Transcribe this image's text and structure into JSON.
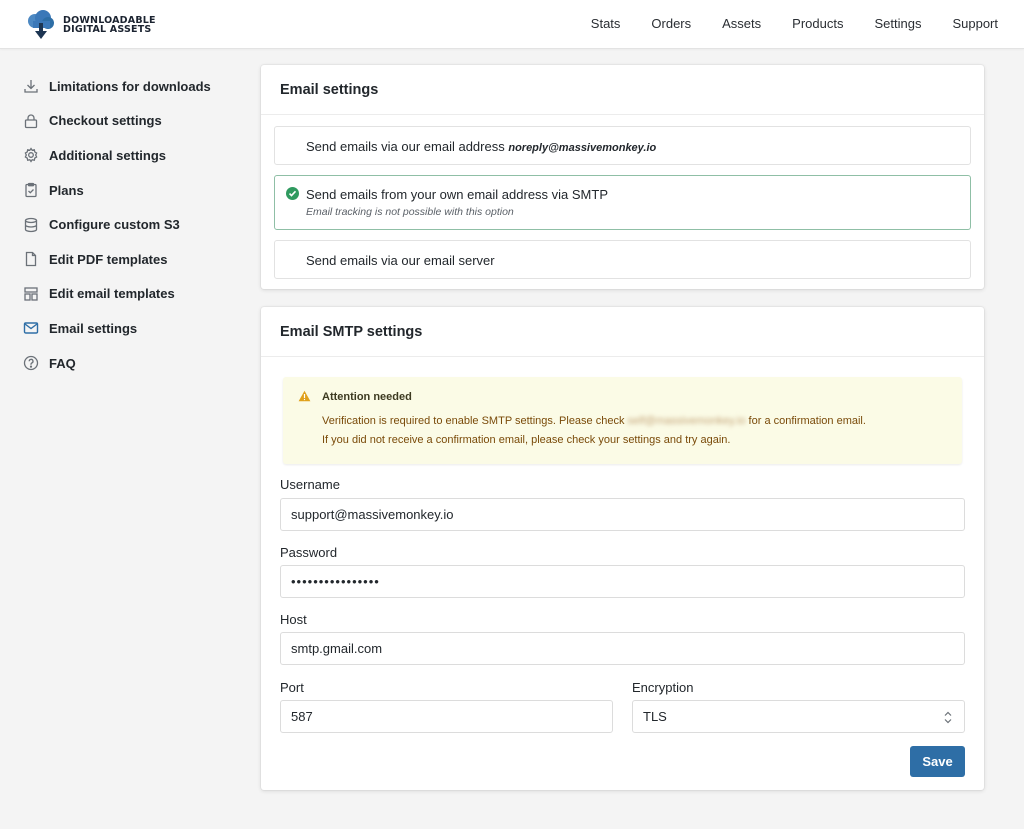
{
  "brand": {
    "line1": "DOWNLOADABLE",
    "line2": "DIGITAL ASSETS"
  },
  "nav": [
    "Stats",
    "Orders",
    "Assets",
    "Products",
    "Settings",
    "Support"
  ],
  "sidebar": {
    "items": [
      {
        "label": "Limitations for downloads",
        "icon": "download-icon"
      },
      {
        "label": "Checkout settings",
        "icon": "lock-icon"
      },
      {
        "label": "Additional settings",
        "icon": "gear-icon"
      },
      {
        "label": "Plans",
        "icon": "clipboard-icon"
      },
      {
        "label": "Configure custom S3",
        "icon": "database-icon"
      },
      {
        "label": "Edit PDF templates",
        "icon": "document-icon"
      },
      {
        "label": "Edit email templates",
        "icon": "template-icon"
      },
      {
        "label": "Email settings",
        "icon": "envelope-icon"
      },
      {
        "label": "FAQ",
        "icon": "question-icon"
      }
    ]
  },
  "email_settings": {
    "title": "Email settings",
    "options": [
      {
        "label": "Send emails via our email address",
        "address": "noreply@massivemonkey.io"
      },
      {
        "label": "Send emails from your own email address via SMTP",
        "note": "Email tracking is not possible with this option",
        "selected": true
      },
      {
        "label": "Send emails via our email server"
      }
    ]
  },
  "smtp": {
    "title": "Email SMTP settings",
    "alert": {
      "title": "Attention needed",
      "line1_start": "Verification is required to enable SMTP settings. Please check",
      "line1_hidden": "self@massivemonkey.io",
      "line1_end": "for a confirmation email.",
      "line2": "If you did not receive a confirmation email, please check your settings and try again."
    },
    "username": {
      "label": "Username",
      "value": "support@massivemonkey.io"
    },
    "password": {
      "label": "Password",
      "value": "••••••••••••••••"
    },
    "host": {
      "label": "Host",
      "value": "smtp.gmail.com"
    },
    "port": {
      "label": "Port",
      "value": "587"
    },
    "encryption": {
      "label": "Encryption",
      "value": "TLS"
    },
    "save_label": "Save"
  },
  "colors": {
    "accent": "#2e6ea6",
    "success": "#2f9a5f",
    "warning": "#e0a11b",
    "alert_bg": "#fbfbe6"
  }
}
